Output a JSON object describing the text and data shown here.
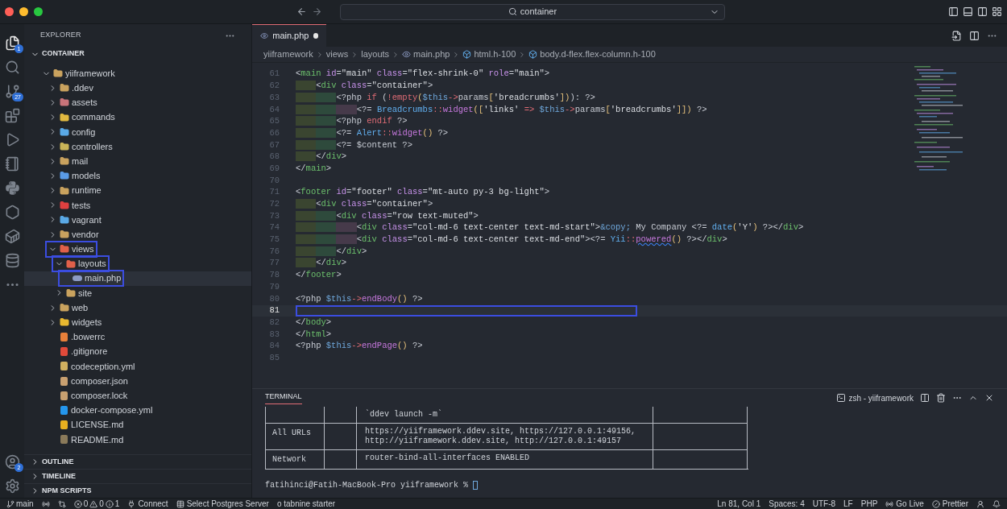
{
  "title_bar": {
    "command_center": "container"
  },
  "activity_bar": [
    {
      "kind": "explorer",
      "selected": true,
      "badge": "1"
    },
    {
      "kind": "search",
      "selected": false
    },
    {
      "kind": "source_control",
      "selected": false,
      "badge": "27"
    },
    {
      "kind": "extensions",
      "selected": false
    },
    {
      "kind": "run",
      "selected": false
    },
    {
      "kind": "notebook",
      "selected": false
    },
    {
      "kind": "python",
      "selected": false
    },
    {
      "kind": "hexagon",
      "selected": false
    },
    {
      "kind": "container",
      "selected": false
    },
    {
      "kind": "database",
      "selected": false
    },
    {
      "kind": "more",
      "selected": false
    }
  ],
  "accounts_badge": "2",
  "sidebar": {
    "title": "EXPLORER",
    "section": "CONTAINER",
    "tree": [
      {
        "name": "yiiframework",
        "kind": "folder",
        "color": "#c9a25e",
        "expanded": true,
        "selected": false,
        "outlined": false,
        "children": [
          {
            "name": ".ddev",
            "kind": "folder",
            "color": "#c9a25e",
            "expanded": false,
            "selected": false,
            "outlined": false
          },
          {
            "name": "assets",
            "kind": "folder",
            "color": "#c9747a",
            "expanded": false,
            "selected": false,
            "outlined": false
          },
          {
            "name": "commands",
            "kind": "folder",
            "color": "#e0b840",
            "expanded": false,
            "selected": false,
            "outlined": false
          },
          {
            "name": "config",
            "kind": "folder",
            "color": "#5aa9e6",
            "expanded": false,
            "selected": false,
            "outlined": false
          },
          {
            "name": "controllers",
            "kind": "folder",
            "color": "#c9b458",
            "expanded": false,
            "selected": false,
            "outlined": false
          },
          {
            "name": "mail",
            "kind": "folder",
            "color": "#c9a25e",
            "expanded": false,
            "selected": false,
            "outlined": false
          },
          {
            "name": "models",
            "kind": "folder",
            "color": "#5a9be6",
            "expanded": false,
            "selected": false,
            "outlined": false
          },
          {
            "name": "runtime",
            "kind": "folder",
            "color": "#c9a25e",
            "expanded": false,
            "selected": false,
            "outlined": false
          },
          {
            "name": "tests",
            "kind": "folder",
            "color": "#e04040",
            "expanded": false,
            "selected": false,
            "outlined": false
          },
          {
            "name": "vagrant",
            "kind": "folder",
            "color": "#5aa9e6",
            "expanded": false,
            "selected": false,
            "outlined": false
          },
          {
            "name": "vendor",
            "kind": "folder",
            "color": "#c9a25e",
            "expanded": false,
            "selected": false,
            "outlined": false
          },
          {
            "name": "views",
            "kind": "folder",
            "color": "#e0604a",
            "expanded": true,
            "selected": false,
            "outlined": true,
            "children": [
              {
                "name": "layouts",
                "kind": "folder",
                "color": "#e0604a",
                "expanded": true,
                "selected": false,
                "outlined": true,
                "children": [
                  {
                    "name": "main.php",
                    "kind": "php",
                    "color": "#8c9bc4",
                    "selected": true,
                    "outlined": true
                  }
                ]
              },
              {
                "name": "site",
                "kind": "folder",
                "color": "#c9a25e",
                "expanded": false,
                "selected": false,
                "outlined": false
              }
            ]
          },
          {
            "name": "web",
            "kind": "folder",
            "color": "#c9a25e",
            "expanded": false,
            "selected": false,
            "outlined": false
          },
          {
            "name": "widgets",
            "kind": "folder",
            "color": "#e8b830",
            "expanded": false,
            "selected": false,
            "outlined": false
          },
          {
            "name": ".bowerrc",
            "kind": "file",
            "color": "#e8803a",
            "selected": false,
            "outlined": false
          },
          {
            "name": ".gitignore",
            "kind": "file",
            "color": "#e04a3a",
            "selected": false,
            "outlined": false
          },
          {
            "name": "codeception.yml",
            "kind": "file",
            "color": "#d0b060",
            "selected": false,
            "outlined": false
          },
          {
            "name": "composer.json",
            "kind": "file",
            "color": "#c8a070",
            "selected": false,
            "outlined": false
          },
          {
            "name": "composer.lock",
            "kind": "file",
            "color": "#c8a070",
            "selected": false,
            "outlined": false
          },
          {
            "name": "docker-compose.yml",
            "kind": "file",
            "color": "#2496ed",
            "selected": false,
            "outlined": false
          },
          {
            "name": "LICENSE.md",
            "kind": "file",
            "color": "#e8b020",
            "selected": false,
            "outlined": false
          },
          {
            "name": "README.md",
            "kind": "file",
            "color": "#8a7a5a",
            "selected": false,
            "outlined": false
          }
        ]
      }
    ],
    "sections": [
      "OUTLINE",
      "TIMELINE",
      "NPM SCRIPTS"
    ]
  },
  "tab": {
    "label": "main.php",
    "selected": true,
    "modified": true
  },
  "breadcrumbs": [
    {
      "text": "yiiframework",
      "kind": "plain"
    },
    {
      "text": "views",
      "kind": "plain"
    },
    {
      "text": "layouts",
      "kind": "plain"
    },
    {
      "text": "main.php",
      "kind": "php"
    },
    {
      "text": "html.h-100",
      "kind": "element"
    },
    {
      "text": "body.d-flex.flex-column.h-100",
      "kind": "element"
    }
  ],
  "lines": [
    {
      "number": "61",
      "current": false,
      "tokens": [
        {
          "kind": "p",
          "text": "<"
        },
        {
          "kind": "tag",
          "text": "main"
        },
        {
          "kind": "attr",
          "text": " id"
        },
        {
          "kind": "p",
          "text": "="
        },
        {
          "kind": "str",
          "text": "\"main\""
        },
        {
          "kind": "attr",
          "text": " class"
        },
        {
          "kind": "p",
          "text": "="
        },
        {
          "kind": "str",
          "text": "\"flex-shrink-0\""
        },
        {
          "kind": "attr",
          "text": " role"
        },
        {
          "kind": "p",
          "text": "="
        },
        {
          "kind": "str",
          "text": "\"main\""
        },
        {
          "kind": "p",
          "text": ">"
        }
      ]
    },
    {
      "number": "62",
      "current": false,
      "tokens": [
        {
          "kind": "p",
          "text": "    <"
        },
        {
          "kind": "tag",
          "text": "div"
        },
        {
          "kind": "attr",
          "text": " class"
        },
        {
          "kind": "p",
          "text": "="
        },
        {
          "kind": "str",
          "text": "\"container\""
        },
        {
          "kind": "p",
          "text": ">"
        }
      ]
    },
    {
      "number": "63",
      "current": false,
      "tokens": [
        {
          "kind": "p",
          "text": "        <?php "
        },
        {
          "kind": "kw",
          "text": "if"
        },
        {
          "kind": "p",
          "text": " ("
        },
        {
          "kind": "kw",
          "text": "!empty"
        },
        {
          "kind": "br",
          "text": "("
        },
        {
          "kind": "var",
          "text": "$this"
        },
        {
          "kind": "op",
          "text": "->"
        },
        {
          "kind": "p",
          "text": "params"
        },
        {
          "kind": "br",
          "text": "["
        },
        {
          "kind": "str",
          "text": "'breadcrumbs'"
        },
        {
          "kind": "br",
          "text": "])"
        },
        {
          "kind": "p",
          "text": "): ?>"
        }
      ]
    },
    {
      "number": "64",
      "current": false,
      "tokens": [
        {
          "kind": "p",
          "text": "            <?= "
        },
        {
          "kind": "cls",
          "text": "Breadcrumbs"
        },
        {
          "kind": "op",
          "text": "::"
        },
        {
          "kind": "fn",
          "text": "widget"
        },
        {
          "kind": "br",
          "text": "(["
        },
        {
          "kind": "str",
          "text": "'links'"
        },
        {
          "kind": "op",
          "text": " => "
        },
        {
          "kind": "var",
          "text": "$this"
        },
        {
          "kind": "op",
          "text": "->"
        },
        {
          "kind": "p",
          "text": "params"
        },
        {
          "kind": "br",
          "text": "["
        },
        {
          "kind": "str",
          "text": "'breadcrumbs'"
        },
        {
          "kind": "br",
          "text": "]])"
        },
        {
          "kind": "p",
          "text": " ?>"
        }
      ]
    },
    {
      "number": "65",
      "current": false,
      "tokens": [
        {
          "kind": "p",
          "text": "        <?php "
        },
        {
          "kind": "kw",
          "text": "endif"
        },
        {
          "kind": "p",
          "text": " ?>"
        }
      ]
    },
    {
      "number": "66",
      "current": false,
      "tokens": [
        {
          "kind": "p",
          "text": "        <?= "
        },
        {
          "kind": "cls",
          "text": "Alert"
        },
        {
          "kind": "op",
          "text": "::"
        },
        {
          "kind": "fn",
          "text": "widget"
        },
        {
          "kind": "br",
          "text": "()"
        },
        {
          "kind": "p",
          "text": " ?>"
        }
      ]
    },
    {
      "number": "67",
      "current": false,
      "tokens": [
        {
          "kind": "p",
          "text": "        <?= $content ?>"
        }
      ]
    },
    {
      "number": "68",
      "current": false,
      "tokens": [
        {
          "kind": "p",
          "text": "    </"
        },
        {
          "kind": "tag",
          "text": "div"
        },
        {
          "kind": "p",
          "text": ">"
        }
      ]
    },
    {
      "number": "69",
      "current": false,
      "tokens": [
        {
          "kind": "p",
          "text": "</"
        },
        {
          "kind": "tag",
          "text": "main"
        },
        {
          "kind": "p",
          "text": ">"
        }
      ]
    },
    {
      "number": "70",
      "current": false
    },
    {
      "number": "71",
      "current": false,
      "tokens": [
        {
          "kind": "p",
          "text": "<"
        },
        {
          "kind": "tag",
          "text": "footer"
        },
        {
          "kind": "attr",
          "text": " id"
        },
        {
          "kind": "p",
          "text": "="
        },
        {
          "kind": "str",
          "text": "\"footer\""
        },
        {
          "kind": "attr",
          "text": " class"
        },
        {
          "kind": "p",
          "text": "="
        },
        {
          "kind": "str",
          "text": "\"mt-auto py-3 bg-light\""
        },
        {
          "kind": "p",
          "text": ">"
        }
      ]
    },
    {
      "number": "72",
      "current": false,
      "tokens": [
        {
          "kind": "p",
          "text": "    <"
        },
        {
          "kind": "tag",
          "text": "div"
        },
        {
          "kind": "attr",
          "text": " class"
        },
        {
          "kind": "p",
          "text": "="
        },
        {
          "kind": "str",
          "text": "\"container\""
        },
        {
          "kind": "p",
          "text": ">"
        }
      ]
    },
    {
      "number": "73",
      "current": false,
      "tokens": [
        {
          "kind": "p",
          "text": "        <"
        },
        {
          "kind": "tag",
          "text": "div"
        },
        {
          "kind": "attr",
          "text": " class"
        },
        {
          "kind": "p",
          "text": "="
        },
        {
          "kind": "str",
          "text": "\"row text-muted\""
        },
        {
          "kind": "p",
          "text": ">"
        }
      ]
    },
    {
      "number": "74",
      "current": false,
      "tokens": [
        {
          "kind": "p",
          "text": "            <"
        },
        {
          "kind": "tag",
          "text": "div"
        },
        {
          "kind": "attr",
          "text": " class"
        },
        {
          "kind": "p",
          "text": "="
        },
        {
          "kind": "str",
          "text": "\"col-md-6 text-center text-md-start\""
        },
        {
          "kind": "p",
          "text": ">"
        },
        {
          "kind": "var",
          "text": "&copy;"
        },
        {
          "kind": "p",
          "text": " My Company <?= "
        },
        {
          "kind": "cls",
          "text": "date"
        },
        {
          "kind": "br",
          "text": "("
        },
        {
          "kind": "str",
          "text": "'Y'"
        },
        {
          "kind": "br",
          "text": ")"
        },
        {
          "kind": "p",
          "text": " ?></"
        },
        {
          "kind": "tag",
          "text": "div"
        },
        {
          "kind": "p",
          "text": ">"
        }
      ]
    },
    {
      "number": "75",
      "current": false,
      "tokens": [
        {
          "kind": "p",
          "text": "            <"
        },
        {
          "kind": "tag",
          "text": "div"
        },
        {
          "kind": "attr",
          "text": " class"
        },
        {
          "kind": "p",
          "text": "="
        },
        {
          "kind": "str",
          "text": "\"col-md-6 text-center text-md-end\""
        },
        {
          "kind": "p",
          "text": "><?= "
        },
        {
          "kind": "cls",
          "text": "Yii"
        },
        {
          "kind": "op",
          "text": "::"
        },
        {
          "kind": "warn",
          "text": "powered"
        },
        {
          "kind": "br",
          "text": "()"
        },
        {
          "kind": "p",
          "text": " ?></"
        },
        {
          "kind": "tag",
          "text": "div"
        },
        {
          "kind": "p",
          "text": ">"
        }
      ]
    },
    {
      "number": "76",
      "current": false,
      "tokens": [
        {
          "kind": "p",
          "text": "        </"
        },
        {
          "kind": "tag",
          "text": "div"
        },
        {
          "kind": "p",
          "text": ">"
        }
      ]
    },
    {
      "number": "77",
      "current": false,
      "tokens": [
        {
          "kind": "p",
          "text": "    </"
        },
        {
          "kind": "tag",
          "text": "div"
        },
        {
          "kind": "p",
          "text": ">"
        }
      ]
    },
    {
      "number": "78",
      "current": false,
      "tokens": [
        {
          "kind": "p",
          "text": "</"
        },
        {
          "kind": "tag",
          "text": "footer"
        },
        {
          "kind": "p",
          "text": ">"
        }
      ]
    },
    {
      "number": "79",
      "current": false
    },
    {
      "number": "80",
      "current": false,
      "tokens": [
        {
          "kind": "p",
          "text": "<?php "
        },
        {
          "kind": "var",
          "text": "$this"
        },
        {
          "kind": "op",
          "text": "->"
        },
        {
          "kind": "fn",
          "text": "endBody"
        },
        {
          "kind": "br",
          "text": "()"
        },
        {
          "kind": "p",
          "text": " ?>"
        }
      ]
    },
    {
      "number": "81",
      "current": true
    },
    {
      "number": "82",
      "current": false,
      "tokens": [
        {
          "kind": "p",
          "text": "</"
        },
        {
          "kind": "tag",
          "text": "body"
        },
        {
          "kind": "p",
          "text": ">"
        }
      ]
    },
    {
      "number": "83",
      "current": false,
      "tokens": [
        {
          "kind": "p",
          "text": "</"
        },
        {
          "kind": "tag",
          "text": "html"
        },
        {
          "kind": "p",
          "text": ">"
        }
      ]
    },
    {
      "number": "84",
      "current": false,
      "tokens": [
        {
          "kind": "p",
          "text": "<?php "
        },
        {
          "kind": "var",
          "text": "$this"
        },
        {
          "kind": "op",
          "text": "->"
        },
        {
          "kind": "fn",
          "text": "endPage"
        },
        {
          "kind": "br",
          "text": "()"
        },
        {
          "kind": "p",
          "text": " ?>"
        }
      ]
    },
    {
      "number": "85",
      "current": false
    }
  ],
  "panel": {
    "tab": {
      "label": "TERMINAL",
      "selected": true
    },
    "shell": "zsh - yiiframework",
    "table": [
      {
        "value": [
          "`ddev launch -m`"
        ]
      },
      {
        "label": "All URLs",
        "value": [
          "https://yiiframework.ddev.site, https://127.0.0.1:49156,",
          "http://yiiframework.ddev.site, http://127.0.0.1:49157"
        ]
      },
      {
        "label": "Network",
        "value": [
          "router-bind-all-interfaces ENABLED"
        ]
      }
    ],
    "prompt": "fatihinci@Fatih-MacBook-Pro yiiframework %"
  },
  "status_bar": {
    "branch": "main",
    "errors": "0",
    "warnings": "0",
    "infos": "1",
    "left": [
      "Connect",
      "Select Postgres Server",
      "o tabnine starter"
    ],
    "right": [
      "Ln 81, Col 1",
      "Spaces: 4",
      "UTF-8",
      "LF",
      "PHP",
      "Go Live",
      "Prettier"
    ]
  }
}
